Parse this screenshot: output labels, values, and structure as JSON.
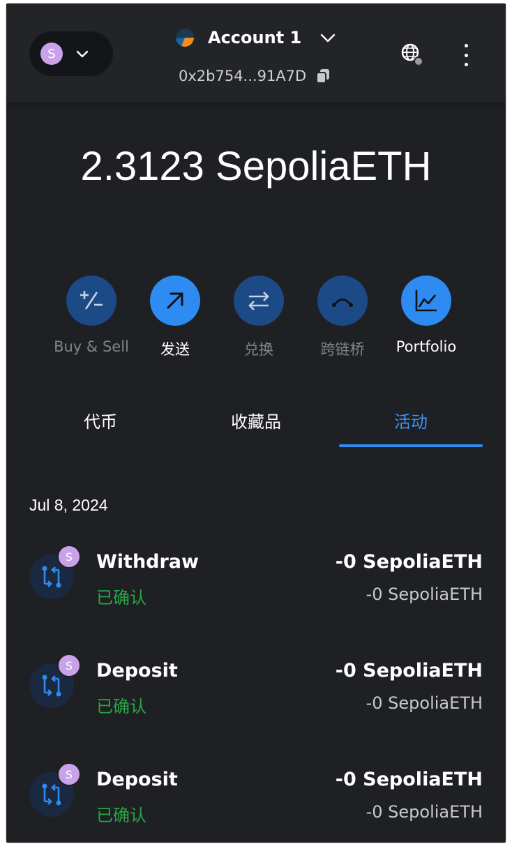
{
  "network": {
    "avatar_letter": "S"
  },
  "account": {
    "name": "Account 1",
    "address": "0x2b754...91A7D"
  },
  "balance": "2.3123 SepoliaETH",
  "actions": [
    {
      "label": "Buy & Sell",
      "icon": "plus-minus-icon",
      "style": "dim"
    },
    {
      "label": "发送",
      "icon": "arrow-up-right-icon",
      "style": "bright"
    },
    {
      "label": "兑换",
      "icon": "swap-arrows-icon",
      "style": "dim"
    },
    {
      "label": "跨链桥",
      "icon": "bridge-icon",
      "style": "dim"
    },
    {
      "label": "Portfolio",
      "icon": "chart-icon",
      "style": "bright"
    }
  ],
  "tabs": [
    {
      "label": "代币",
      "active": false
    },
    {
      "label": "收藏品",
      "active": false
    },
    {
      "label": "活动",
      "active": true
    }
  ],
  "activity": {
    "date": "Jul 8, 2024",
    "items": [
      {
        "title": "Withdraw",
        "status": "已确认",
        "amount": "-0 SepoliaETH",
        "sub": "-0 SepoliaETH",
        "badge": "S"
      },
      {
        "title": "Deposit",
        "status": "已确认",
        "amount": "-0 SepoliaETH",
        "sub": "-0 SepoliaETH",
        "badge": "S"
      },
      {
        "title": "Deposit",
        "status": "已确认",
        "amount": "-0 SepoliaETH",
        "sub": "-0 SepoliaETH",
        "badge": "S"
      }
    ]
  },
  "colors": {
    "accent": "#2e8bf2",
    "accent_dim": "#1c4a86",
    "success": "#28a745",
    "background": "#1f2023"
  }
}
